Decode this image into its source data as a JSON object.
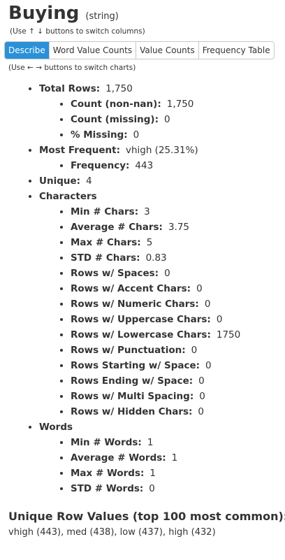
{
  "header": {
    "column_name": "Buying",
    "dtype": "(string)",
    "column_hint": "(Use ↑ ↓ buttons to switch columns)"
  },
  "tabs": [
    {
      "label": "Describe",
      "active": true
    },
    {
      "label": "Word Value Counts",
      "active": false
    },
    {
      "label": "Value Counts",
      "active": false
    },
    {
      "label": "Frequency Table",
      "active": false
    }
  ],
  "chart_hint": "(Use ← → buttons to switch charts)",
  "stats": {
    "total_rows": {
      "label": "Total Rows:",
      "value": "1,750"
    },
    "count_non_nan": {
      "label": "Count (non-nan):",
      "value": "1,750"
    },
    "count_missing": {
      "label": "Count (missing):",
      "value": "0"
    },
    "pct_missing": {
      "label": "% Missing:",
      "value": "0"
    },
    "most_frequent": {
      "label": "Most Frequent:",
      "value": "vhigh (25.31%)"
    },
    "frequency": {
      "label": "Frequency:",
      "value": "443"
    },
    "unique": {
      "label": "Unique:",
      "value": "4"
    },
    "characters_label": "Characters",
    "characters": [
      {
        "label": "Min # Chars:",
        "value": "3"
      },
      {
        "label": "Average # Chars:",
        "value": "3.75"
      },
      {
        "label": "Max # Chars:",
        "value": "5"
      },
      {
        "label": "STD # Chars:",
        "value": "0.83"
      },
      {
        "label": "Rows w/ Spaces:",
        "value": "0"
      },
      {
        "label": "Rows w/ Accent Chars:",
        "value": "0"
      },
      {
        "label": "Rows w/ Numeric Chars:",
        "value": "0"
      },
      {
        "label": "Rows w/ Uppercase Chars:",
        "value": "0"
      },
      {
        "label": "Rows w/ Lowercase Chars:",
        "value": "1750"
      },
      {
        "label": "Rows w/ Punctuation:",
        "value": "0"
      },
      {
        "label": "Rows Starting w/ Space:",
        "value": "0"
      },
      {
        "label": "Rows Ending w/ Space:",
        "value": "0"
      },
      {
        "label": "Rows w/ Multi Spacing:",
        "value": "0"
      },
      {
        "label": "Rows w/ Hidden Chars:",
        "value": "0"
      }
    ],
    "words_label": "Words",
    "words": [
      {
        "label": "Min # Words:",
        "value": "1"
      },
      {
        "label": "Average # Words:",
        "value": "1"
      },
      {
        "label": "Max # Words:",
        "value": "1"
      },
      {
        "label": "STD # Words:",
        "value": "0"
      }
    ]
  },
  "unique_values": {
    "title": "Unique Row Values (top 100 most common):",
    "values": "vhigh (443), med (438), low (437), high (432)"
  },
  "colors": {
    "active_tab": "#2a91d8",
    "text": "#333333"
  }
}
